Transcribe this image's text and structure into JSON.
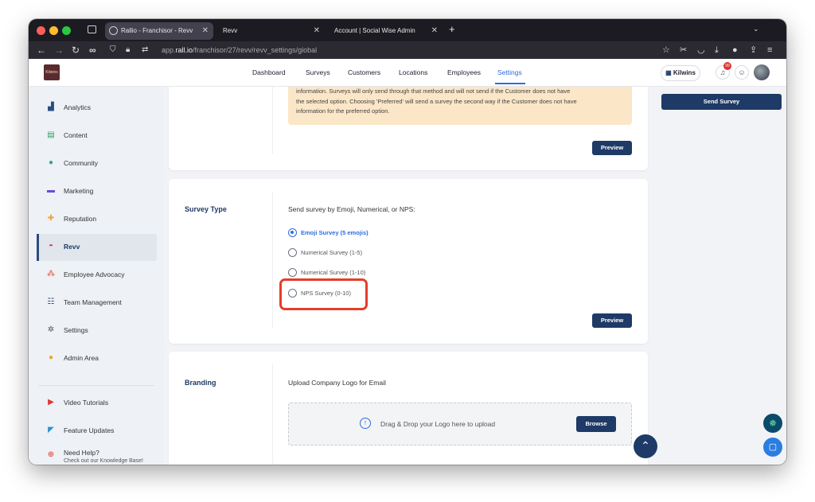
{
  "browser": {
    "tabs": [
      {
        "label": "Rallio - Franchisor - Revv",
        "active": true
      },
      {
        "label": "Revv",
        "active": false
      },
      {
        "label": "Account | Social Wise Admin",
        "active": false
      }
    ],
    "new_tab": "+",
    "url_prefix": "app.",
    "url_domain": "rall.io",
    "url_path": "/franchisor/27/revv/revv_settings/global"
  },
  "header": {
    "logo_text": "Kilwins",
    "nav": [
      "Dashboard",
      "Surveys",
      "Customers",
      "Locations",
      "Employees",
      "Settings"
    ],
    "active_nav": "Settings",
    "brand_label": "Kilwins",
    "notification_count": "99"
  },
  "sidebar": {
    "items": [
      {
        "label": "Analytics",
        "icon": "analytics-icon"
      },
      {
        "label": "Content",
        "icon": "content-icon"
      },
      {
        "label": "Community",
        "icon": "community-icon"
      },
      {
        "label": "Marketing",
        "icon": "marketing-icon"
      },
      {
        "label": "Reputation",
        "icon": "reputation-icon"
      },
      {
        "label": "Revv",
        "icon": "revv-icon"
      },
      {
        "label": "Employee Advocacy",
        "icon": "employee-advocacy-icon"
      },
      {
        "label": "Team Management",
        "icon": "team-management-icon"
      },
      {
        "label": "Settings",
        "icon": "settings-icon"
      },
      {
        "label": "Admin Area",
        "icon": "admin-area-icon"
      }
    ],
    "bottom": [
      {
        "label": "Video Tutorials"
      },
      {
        "label": "Feature Updates"
      },
      {
        "label": "Need Help?",
        "sub": "Check out our Knowledge Base!"
      }
    ]
  },
  "method_card": {
    "note_lines": [
      "information. Surveys will only send through that method and will not send if the Customer does not have",
      "the selected option. Choosing 'Preferred' will send a survey the second way if the Customer does not have",
      "information for the preferred option."
    ],
    "preview_label": "Preview"
  },
  "survey_type": {
    "title": "Survey Type",
    "prompt": "Send survey by Emoji, Numerical, or NPS:",
    "options": [
      {
        "label": "Emoji Survey (5 emojis)",
        "selected": true
      },
      {
        "label": "Numerical Survey (1-5)",
        "selected": false
      },
      {
        "label": "Numerical Survey (1-10)",
        "selected": false
      },
      {
        "label": "NPS Survey (0-10)",
        "selected": false
      }
    ],
    "preview_label": "Preview"
  },
  "branding": {
    "title": "Branding",
    "prompt": "Upload Company Logo for Email",
    "dropzone_text": "Drag & Drop your Logo here to upload",
    "browse_label": "Browse"
  },
  "right_panel": {
    "send_survey_label": "Send Survey"
  },
  "colors": {
    "primary": "#1e3a66",
    "accent": "#2b6de2",
    "highlight": "#e43e2b",
    "note_bg": "#fbe6c8"
  }
}
